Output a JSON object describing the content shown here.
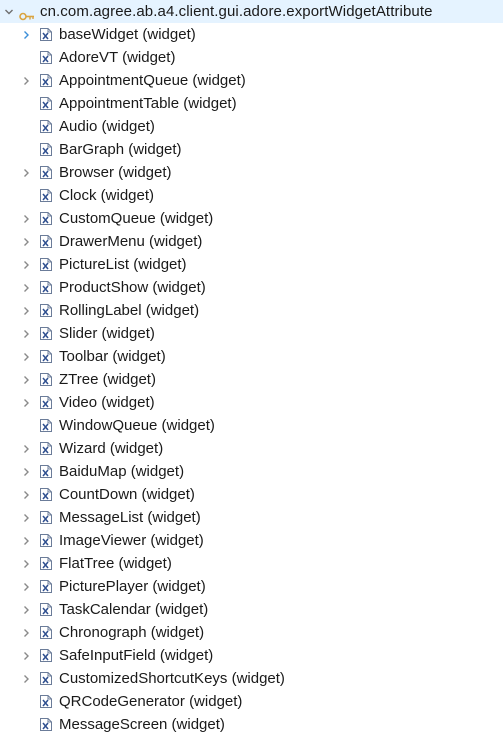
{
  "tree": {
    "root": {
      "label": "cn.com.agree.ab.a4.client.gui.adore.exportWidgetAttribute",
      "expanded": true,
      "icon": "package-key-icon"
    },
    "items": [
      {
        "label": "baseWidget (widget)",
        "expandable": true,
        "selected_chevron": true
      },
      {
        "label": "AdoreVT (widget)",
        "expandable": false
      },
      {
        "label": "AppointmentQueue (widget)",
        "expandable": true
      },
      {
        "label": "AppointmentTable (widget)",
        "expandable": false
      },
      {
        "label": "Audio (widget)",
        "expandable": false
      },
      {
        "label": "BarGraph (widget)",
        "expandable": false
      },
      {
        "label": "Browser (widget)",
        "expandable": true
      },
      {
        "label": "Clock (widget)",
        "expandable": false
      },
      {
        "label": "CustomQueue (widget)",
        "expandable": true
      },
      {
        "label": "DrawerMenu (widget)",
        "expandable": true
      },
      {
        "label": "PictureList (widget)",
        "expandable": true
      },
      {
        "label": "ProductShow (widget)",
        "expandable": true
      },
      {
        "label": "RollingLabel (widget)",
        "expandable": true
      },
      {
        "label": "Slider (widget)",
        "expandable": true
      },
      {
        "label": "Toolbar (widget)",
        "expandable": true
      },
      {
        "label": "ZTree (widget)",
        "expandable": true
      },
      {
        "label": "Video (widget)",
        "expandable": true
      },
      {
        "label": "WindowQueue (widget)",
        "expandable": false
      },
      {
        "label": "Wizard (widget)",
        "expandable": true
      },
      {
        "label": "BaiduMap (widget)",
        "expandable": true
      },
      {
        "label": "CountDown (widget)",
        "expandable": true
      },
      {
        "label": "MessageList (widget)",
        "expandable": true
      },
      {
        "label": "ImageViewer (widget)",
        "expandable": true
      },
      {
        "label": "FlatTree (widget)",
        "expandable": true
      },
      {
        "label": "PicturePlayer (widget)",
        "expandable": true
      },
      {
        "label": "TaskCalendar (widget)",
        "expandable": true
      },
      {
        "label": "Chronograph (widget)",
        "expandable": true
      },
      {
        "label": "SafeInputField (widget)",
        "expandable": true
      },
      {
        "label": "CustomizedShortcutKeys (widget)",
        "expandable": true
      },
      {
        "label": "QRCodeGenerator (widget)",
        "expandable": false
      },
      {
        "label": "MessageScreen (widget)",
        "expandable": false
      }
    ],
    "item_icon": "xml-file-icon",
    "colors": {
      "chevron": "#8a8a8a",
      "chevron_active": "#3c8fd9",
      "file_icon_border": "#6b7c99",
      "file_icon_mark": "#2f4f8f",
      "package_icon": "#d9a441"
    }
  }
}
